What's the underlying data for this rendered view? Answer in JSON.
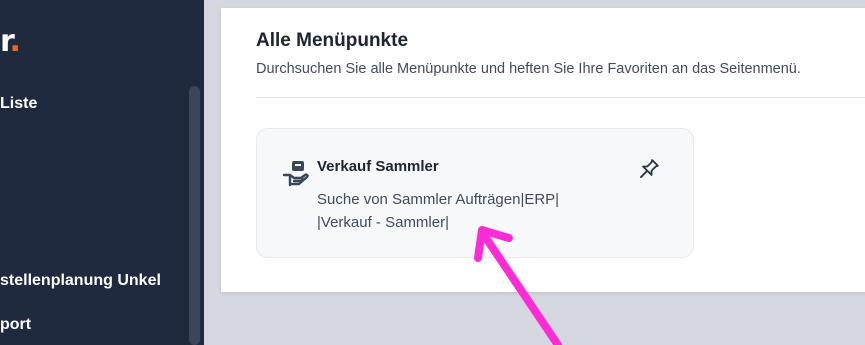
{
  "sidebar": {
    "logo_fragment": "r",
    "logo_dot": ".",
    "items": [
      {
        "label": "Liste"
      },
      {
        "label": "stellenplanung Unkel"
      },
      {
        "label": "port"
      }
    ]
  },
  "main": {
    "title": "Alle Menüpunkte",
    "subtitle": "Durchsuchen Sie alle Menüpunkte und heften Sie Ihre Favoriten an das Seitenmenü.",
    "cards": [
      {
        "title": "Verkauf Sammler",
        "description": "Suche von Sammler Aufträgen|ERP| |Verkauf - Sammler|",
        "icon": "hand-box-icon",
        "action_icon": "pin-icon"
      }
    ]
  },
  "colors": {
    "sidebar_bg": "#1f2a3e",
    "accent": "#f26522",
    "annotation_arrow": "#ff2bd6"
  }
}
